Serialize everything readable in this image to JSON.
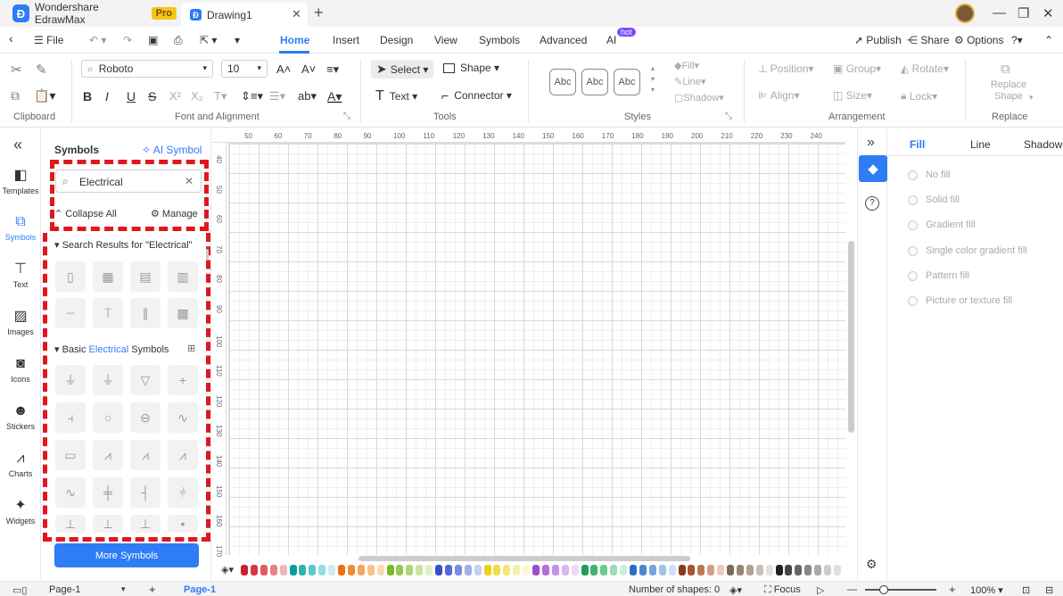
{
  "app": {
    "name": "Wondershare EdrawMax",
    "badge": "Pro",
    "doc_tab": "Drawing1"
  },
  "menu": {
    "file": "File",
    "tabs": [
      "Home",
      "Insert",
      "Design",
      "View",
      "Symbols",
      "Advanced",
      "AI"
    ],
    "ai_badge": "hot",
    "publish": "Publish",
    "share": "Share",
    "options": "Options"
  },
  "ribbon": {
    "font": "Roboto",
    "size": "10",
    "select": "Select",
    "shape": "Shape",
    "text": "Text",
    "connector": "Connector",
    "style_samples": [
      "Abc",
      "Abc",
      "Abc"
    ],
    "fill": "Fill",
    "line": "Line",
    "shadow": "Shadow",
    "position": "Position",
    "group": "Group",
    "rotate": "Rotate",
    "align": "Align",
    "size_label": "Size",
    "lock": "Lock",
    "replace_shape": "Replace Shape",
    "groups": {
      "clipboard": "Clipboard",
      "font": "Font and Alignment",
      "tools": "Tools",
      "styles": "Styles",
      "arrangement": "Arrangement",
      "replace": "Replace"
    }
  },
  "leftbar": [
    "Templates",
    "Symbols",
    "Text",
    "Images",
    "Icons",
    "Stickers",
    "Charts",
    "Widgets"
  ],
  "panel": {
    "title": "Symbols",
    "ai_symbol": "AI Symbol",
    "search_value": "Electrical",
    "collapse_all": "Collapse All",
    "manage": "Manage",
    "results_heading": "Search Results for  \"Electrical\"",
    "basic_prefix": "Basic ",
    "basic_highlight": "Electrical",
    "basic_suffix": " Symbols",
    "more_symbols": "More Symbols"
  },
  "ruler": {
    "h": [
      "50",
      "60",
      "70",
      "80",
      "90",
      "100",
      "110",
      "120",
      "130",
      "140",
      "150",
      "160",
      "170",
      "180",
      "190",
      "200",
      "210",
      "220",
      "230",
      "240"
    ],
    "v": [
      "40",
      "50",
      "60",
      "70",
      "80",
      "90",
      "100",
      "110",
      "120",
      "130",
      "140",
      "150",
      "160",
      "170"
    ]
  },
  "rightpanel": {
    "tabs": [
      "Fill",
      "Line",
      "Shadow"
    ],
    "options": [
      "No fill",
      "Solid fill",
      "Gradient fill",
      "Single color gradient fill",
      "Pattern fill",
      "Picture or texture fill"
    ]
  },
  "colors": {
    "accent": "#2e7cf6",
    "highlight": "#e3161b"
  },
  "palette": [
    "#c4232b",
    "#d9363e",
    "#e05b63",
    "#e98087",
    "#f2b3b7",
    "#0f9b9b",
    "#2fb3b3",
    "#5cc8c8",
    "#93dede",
    "#c9eeee",
    "#e8720c",
    "#f08c2e",
    "#f5a55a",
    "#f9c088",
    "#fcd9b6",
    "#78b829",
    "#93c94f",
    "#aed677",
    "#c8e39f",
    "#e0efc7",
    "#3a4fc4",
    "#5468d4",
    "#7a8be0",
    "#a0adea",
    "#c7cff3",
    "#e8d213",
    "#efdd45",
    "#f3e678",
    "#f7efa7",
    "#fbf7d3",
    "#9b4fd0",
    "#b070dc",
    "#c593e6",
    "#d9b7ef",
    "#ecdaf7",
    "#1f9d55",
    "#3fb46e",
    "#6cc890",
    "#9bdcb3",
    "#cbeed8",
    "#2b6ec4",
    "#4c87d0",
    "#75a4dd",
    "#a2c1e9",
    "#d0e1f4",
    "#8b3a1c",
    "#a5532f",
    "#bc7757",
    "#d29f86",
    "#e8cbbb",
    "#7a6a5a",
    "#948574",
    "#aea294",
    "#c9c0b6",
    "#e4dfd9",
    "#222",
    "#444",
    "#666",
    "#888",
    "#aaa",
    "#ccc",
    "#e0e0e0"
  ],
  "status": {
    "page_select": "Page-1",
    "page_tab": "Page-1",
    "shapes": "Number of shapes: 0",
    "focus": "Focus",
    "zoom": "100%"
  }
}
